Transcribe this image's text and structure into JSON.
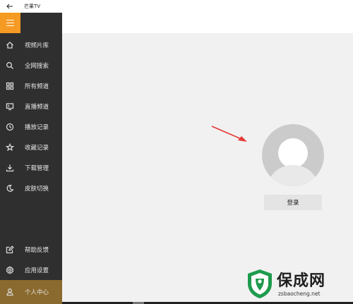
{
  "window": {
    "title": "芒果TV"
  },
  "sidebar": {
    "items": [
      {
        "label": "视频片库",
        "icon": "home-icon"
      },
      {
        "label": "全网搜索",
        "icon": "search-icon"
      },
      {
        "label": "所有频道",
        "icon": "grid-icon"
      },
      {
        "label": "直播频道",
        "icon": "tv-icon"
      },
      {
        "label": "播放记录",
        "icon": "clock-icon"
      },
      {
        "label": "收藏记录",
        "icon": "star-icon"
      },
      {
        "label": "下载管理",
        "icon": "download-icon"
      },
      {
        "label": "皮肤切换",
        "icon": "moon-icon"
      }
    ],
    "bottom_items": [
      {
        "label": "帮助反馈",
        "icon": "edit-icon"
      },
      {
        "label": "应用设置",
        "icon": "gear-icon"
      },
      {
        "label": "个人中心",
        "icon": "user-icon",
        "active": true
      }
    ]
  },
  "main": {
    "login_label": "登录"
  },
  "watermark": {
    "title": "保成网",
    "url": "zsbaocheng.net"
  },
  "colors": {
    "accent": "#f59a22",
    "sidebar_bg": "#2f2f2f",
    "active_bg": "#8a6a2e",
    "content_bg": "#f1f1f1",
    "arrow": "#e53935"
  }
}
